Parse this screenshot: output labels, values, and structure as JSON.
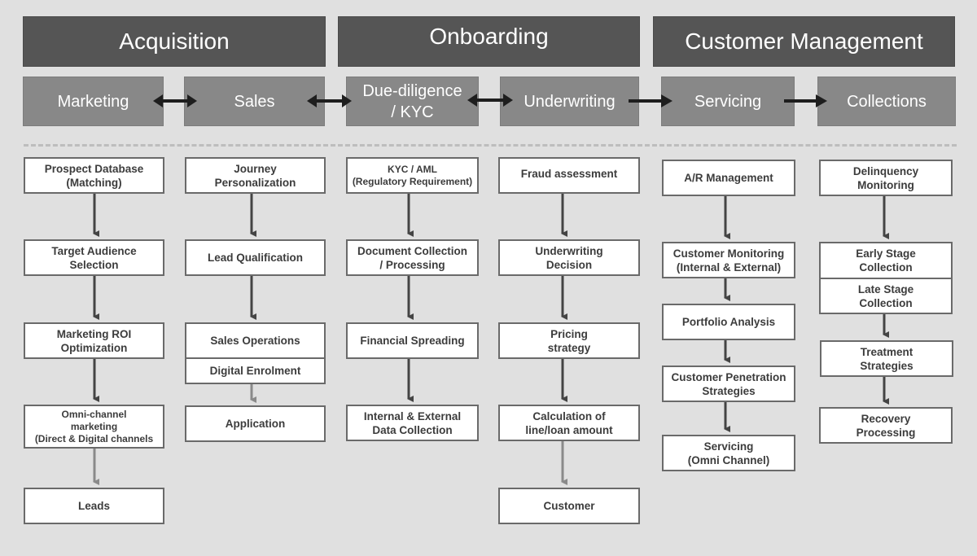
{
  "phases": [
    {
      "label": "Acquisition"
    },
    {
      "label": "Onboarding"
    },
    {
      "label": "Customer Management"
    }
  ],
  "stages": [
    {
      "label": "Marketing"
    },
    {
      "label": "Sales"
    },
    {
      "label": "Due-diligence\n/ KYC"
    },
    {
      "label": "Underwriting"
    },
    {
      "label": "Servicing"
    },
    {
      "label": "Collections"
    }
  ],
  "stage_links": [
    {
      "from": "Marketing",
      "to": "Sales",
      "type": "bidirectional"
    },
    {
      "from": "Sales",
      "to": "Due-diligence / KYC",
      "type": "bidirectional"
    },
    {
      "from": "Due-diligence / KYC",
      "to": "Underwriting",
      "type": "bidirectional"
    },
    {
      "from": "Underwriting",
      "to": "Servicing",
      "type": "forward"
    },
    {
      "from": "Servicing",
      "to": "Collections",
      "type": "forward"
    }
  ],
  "columns": {
    "marketing": [
      "Prospect Database\n(Matching)",
      "Target Audience\nSelection",
      "Marketing ROI\nOptimization",
      "Omni-channel\nmarketing\n(Direct & Digital channels",
      "Leads"
    ],
    "sales": [
      "Journey\nPersonalization",
      "Lead Qualification",
      "Sales Operations",
      "Digital Enrolment",
      "Application"
    ],
    "kyc": [
      "KYC / AML\n(Regulatory Requirement)",
      "Document Collection\n/ Processing",
      "Financial Spreading",
      "Internal & External\nData Collection"
    ],
    "underwriting": [
      "Fraud assessment",
      "Underwriting\nDecision",
      "Pricing\nstrategy",
      "Calculation of\nline/loan amount",
      "Customer"
    ],
    "servicing": [
      "A/R Management",
      "Customer Monitoring\n(Internal & External)",
      "Portfolio Analysis",
      "Customer Penetration\nStrategies",
      "Servicing\n(Omni Channel)"
    ],
    "collections": [
      "Delinquency\nMonitoring",
      "Early Stage\nCollection",
      "Late Stage\nCollection",
      "Treatment\nStrategies",
      "Recovery\nProcessing"
    ]
  },
  "colors": {
    "background": "#e0e0e0",
    "phase_header": "#555555",
    "stage_header": "#888888",
    "box_fill": "#ffffff",
    "box_border": "#6a6a6a",
    "arrow_dark": "#444444",
    "arrow_light": "#8a8a8a"
  }
}
